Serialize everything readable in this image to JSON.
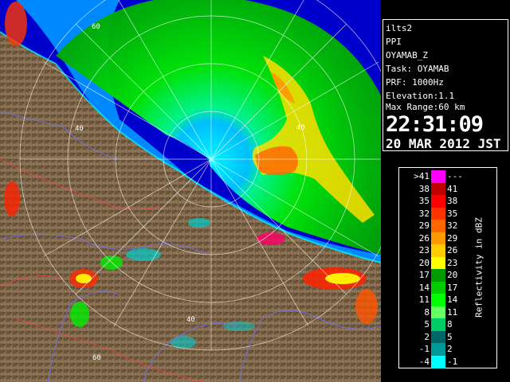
{
  "info": {
    "lines": [
      "ilts2",
      "PPI",
      "OYAMAB_Z",
      "Task: OYAMAB",
      "PRF: 1000Hz",
      "Elevation:1.1",
      "Max Range:60 km"
    ],
    "time": "22:31:09",
    "date": "20 MAR 2012 JST"
  },
  "legend": {
    "title": "Reflectivity in dBZ",
    "rows": [
      {
        "lo": ">41",
        "hi": "---",
        "color": "#ff00ff"
      },
      {
        "lo": "38",
        "hi": "41",
        "color": "#c00000"
      },
      {
        "lo": "35",
        "hi": "38",
        "color": "#ff0000"
      },
      {
        "lo": "32",
        "hi": "35",
        "color": "#ff3300"
      },
      {
        "lo": "29",
        "hi": "32",
        "color": "#ff6600"
      },
      {
        "lo": "26",
        "hi": "29",
        "color": "#ff9900"
      },
      {
        "lo": "23",
        "hi": "26",
        "color": "#ffcc00"
      },
      {
        "lo": "20",
        "hi": "23",
        "color": "#ffff00"
      },
      {
        "lo": "17",
        "hi": "20",
        "color": "#009900"
      },
      {
        "lo": "14",
        "hi": "17",
        "color": "#00cc00"
      },
      {
        "lo": "11",
        "hi": "14",
        "color": "#00ff00"
      },
      {
        "lo": "8",
        "hi": "11",
        "color": "#66ff66"
      },
      {
        "lo": "5",
        "hi": "8",
        "color": "#00cc66"
      },
      {
        "lo": "2",
        "hi": "5",
        "color": "#006666"
      },
      {
        "lo": "-1",
        "hi": "2",
        "color": "#009999"
      },
      {
        "lo": "-4",
        "hi": "-1",
        "color": "#00ffff"
      }
    ]
  },
  "map": {
    "range_labels": [
      "60",
      "40",
      "40",
      "40",
      "60"
    ],
    "colors": {
      "land": "#7a6448",
      "sea": "#0000dd",
      "coast_sea": "#0070ff",
      "grid": "#ffffff"
    }
  }
}
